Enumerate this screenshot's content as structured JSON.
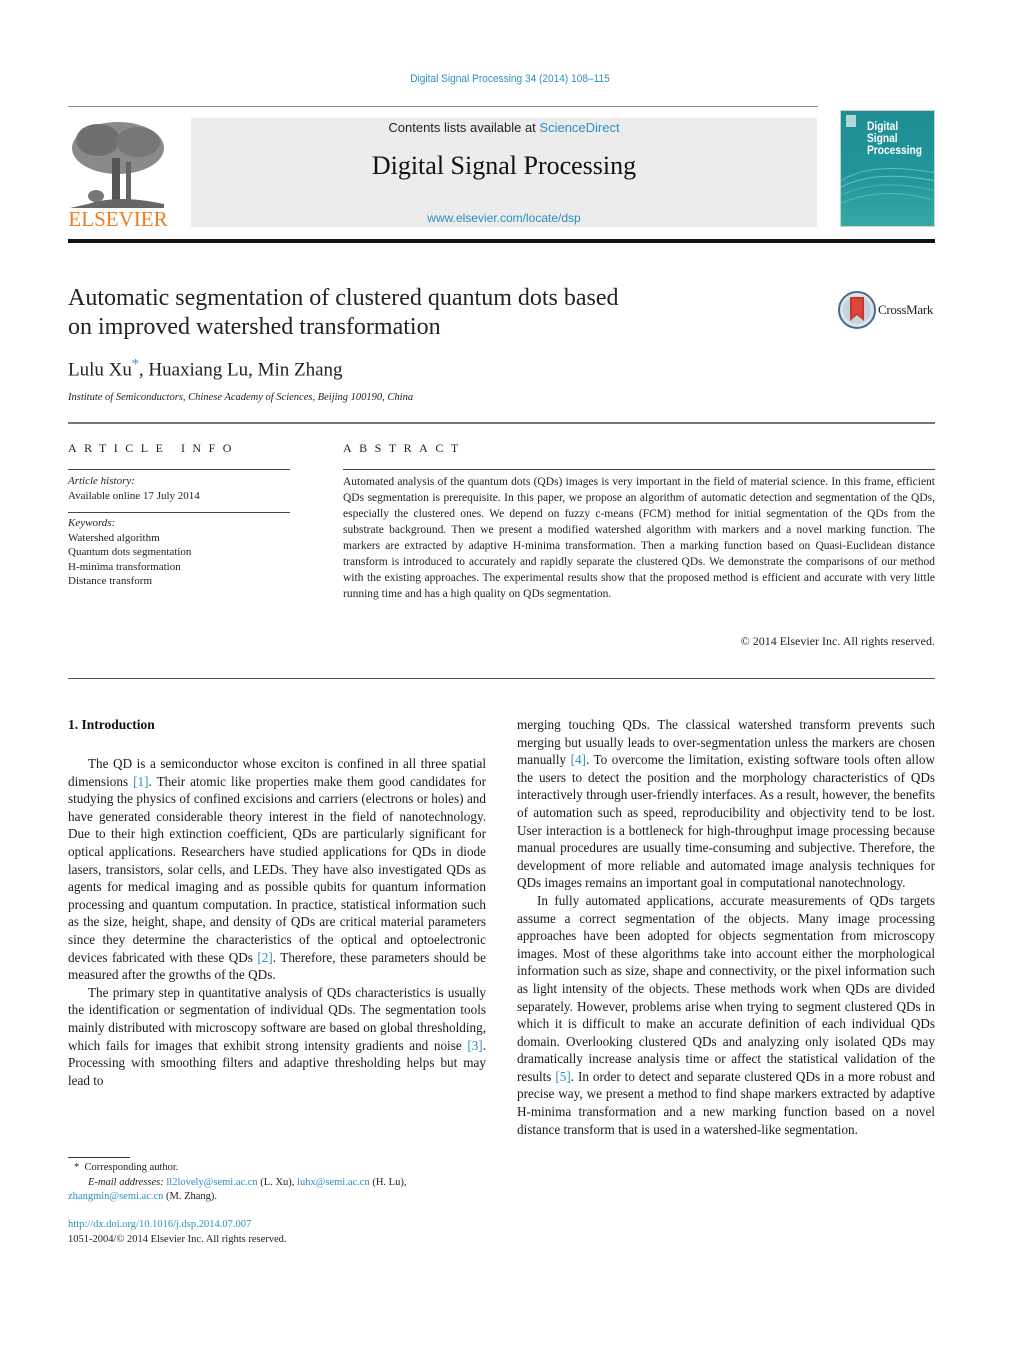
{
  "header": {
    "journal_reference": "Digital Signal Processing 34 (2014) 108–115",
    "contents_prefix": "Contents lists available at ",
    "contents_link": "ScienceDirect",
    "journal_name": "Digital Signal Processing",
    "journal_url": "www.elsevier.com/locate/dsp",
    "publisher_logo_text": "ELSEVIER",
    "cover_title_lines": [
      "Digital",
      "Signal",
      "Processing"
    ],
    "crossmark_label": "CrossMark",
    "colors": {
      "link": "#2a8fbd",
      "elsevier_orange": "#f07c1e",
      "cover_teal": "#1f8e93"
    }
  },
  "article": {
    "title_line1": "Automatic segmentation of clustered quantum dots based",
    "title_line2": "on improved watershed transformation",
    "authors": [
      {
        "name": "Lulu Xu",
        "mark": "*"
      },
      {
        "name": "Huaxiang Lu"
      },
      {
        "name": "Min Zhang"
      }
    ],
    "affiliation": "Institute of Semiconductors, Chinese Academy of Sciences, Beijing 100190, China"
  },
  "article_info": {
    "heading": "ARTICLE INFO",
    "history_label": "Article history:",
    "history_value": "Available online 17 July 2014",
    "keywords_label": "Keywords:",
    "keywords": [
      "Watershed algorithm",
      "Quantum dots segmentation",
      "H-minima transformation",
      "Distance transform"
    ]
  },
  "abstract": {
    "heading": "ABSTRACT",
    "text": "Automated analysis of the quantum dots (QDs) images is very important in the field of material science. In this frame, efficient QDs segmentation is prerequisite. In this paper, we propose an algorithm of automatic detection and segmentation of the QDs, especially the clustered ones. We depend on fuzzy c-means (FCM) method for initial segmentation of the QDs from the substrate background. Then we present a modified watershed algorithm with markers and a novel marking function. The markers are extracted by adaptive H-minima transformation. Then a marking function based on Quasi-Euclidean distance transform is introduced to accurately and rapidly separate the clustered QDs. We demonstrate the comparisons of our method with the existing approaches. The experimental results show that the proposed method is efficient and accurate with very little running time and has a high quality on QDs segmentation.",
    "copyright": "© 2014 Elsevier Inc. All rights reserved."
  },
  "body": {
    "section_heading": "1.  Introduction",
    "col1": {
      "p1_a": "The QD is a semiconductor whose exciton is confined in all three spatial dimensions ",
      "p1_ref1": "[1]",
      "p1_b": ". Their atomic like properties make them good candidates for studying the physics of confined excisions and carriers (electrons or holes) and have generated considerable theory interest in the field of nanotechnology. Due to their high extinction coefficient, QDs are particularly significant for optical applications. Researchers have studied applications for QDs in diode lasers, transistors, solar cells, and LEDs. They have also investigated QDs as agents for medical imaging and as possible qubits for quantum information processing and quantum computation. In practice, statistical information such as the size, height, shape, and density of QDs are critical material parameters since they determine the characteristics of the optical and optoelectronic devices fabricated with these QDs ",
      "p1_ref2": "[2]",
      "p1_c": ". Therefore, these parameters should be measured after the growths of the QDs.",
      "p2_a": "The primary step in quantitative analysis of QDs characteristics is usually the identification or segmentation of individual QDs. The segmentation tools mainly distributed with microscopy software are based on global thresholding, which fails for images that exhibit strong intensity gradients and noise ",
      "p2_ref3": "[3]",
      "p2_b": ". Processing with smoothing filters and adaptive thresholding helps but may lead to"
    },
    "col2": {
      "p2_cont_a": "merging touching QDs. The classical watershed transform prevents such merging but usually leads to over-segmentation unless the markers are chosen manually ",
      "p2_ref4": "[4]",
      "p2_cont_b": ". To overcome the limitation, existing software tools often allow the users to detect the position and the morphology characteristics of QDs interactively through user-friendly interfaces. As a result, however, the benefits of automation such as speed, reproducibility and objectivity tend to be lost. User interaction is a bottleneck for high-throughput image processing because manual procedures are usually time-consuming and subjective. Therefore, the development of more reliable and automated image analysis techniques for QDs images remains an important goal in computational nanotechnology.",
      "p3_a": "In fully automated applications, accurate measurements of QDs targets assume a correct segmentation of the objects. Many image processing approaches have been adopted for objects segmentation from microscopy images. Most of these algorithms take into account either the morphological information such as size, shape and connectivity, or the pixel information such as light intensity of the objects. These methods work when QDs are divided separately. However, problems arise when trying to segment clustered QDs in which it is difficult to make an accurate definition of each individual QDs domain. Overlooking clustered QDs and analyzing only isolated QDs may dramatically increase analysis time or affect the statistical validation of the results ",
      "p3_ref5": "[5]",
      "p3_b": ". In order to detect and separate clustered QDs in a more robust and precise way, we present a method to find shape markers extracted by adaptive H-minima transformation and a new marking function based on a novel distance transform that is used in a watershed-like segmentation."
    }
  },
  "footnote": {
    "star": "*",
    "corresponding": "Corresponding author.",
    "emails_label": "E-mail addresses:",
    "emails": [
      {
        "address": "ll2lovely@semi.ac.cn",
        "who": " (L. Xu), "
      },
      {
        "address": "luhx@semi.ac.cn",
        "who": " (H. Lu),"
      },
      {
        "address": "zhangmin@semi.ac.cn",
        "who": " (M. Zhang)."
      }
    ],
    "doi": "http://dx.doi.org/10.1016/j.dsp.2014.07.007",
    "issn_copyright": "1051-2004/© 2014 Elsevier Inc. All rights reserved."
  }
}
